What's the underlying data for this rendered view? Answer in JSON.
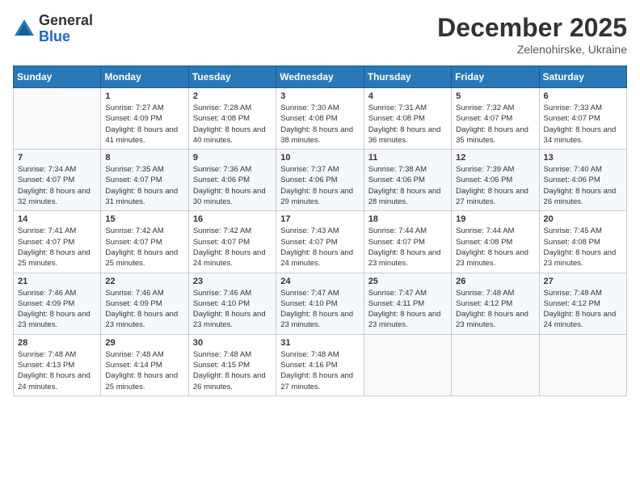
{
  "header": {
    "logo_general": "General",
    "logo_blue": "Blue",
    "month_title": "December 2025",
    "location": "Zelenohirske, Ukraine"
  },
  "weekdays": [
    "Sunday",
    "Monday",
    "Tuesday",
    "Wednesday",
    "Thursday",
    "Friday",
    "Saturday"
  ],
  "weeks": [
    [
      {
        "day": "",
        "sunrise": "",
        "sunset": "",
        "daylight": ""
      },
      {
        "day": "1",
        "sunrise": "Sunrise: 7:27 AM",
        "sunset": "Sunset: 4:09 PM",
        "daylight": "Daylight: 8 hours and 41 minutes."
      },
      {
        "day": "2",
        "sunrise": "Sunrise: 7:28 AM",
        "sunset": "Sunset: 4:08 PM",
        "daylight": "Daylight: 8 hours and 40 minutes."
      },
      {
        "day": "3",
        "sunrise": "Sunrise: 7:30 AM",
        "sunset": "Sunset: 4:08 PM",
        "daylight": "Daylight: 8 hours and 38 minutes."
      },
      {
        "day": "4",
        "sunrise": "Sunrise: 7:31 AM",
        "sunset": "Sunset: 4:08 PM",
        "daylight": "Daylight: 8 hours and 36 minutes."
      },
      {
        "day": "5",
        "sunrise": "Sunrise: 7:32 AM",
        "sunset": "Sunset: 4:07 PM",
        "daylight": "Daylight: 8 hours and 35 minutes."
      },
      {
        "day": "6",
        "sunrise": "Sunrise: 7:33 AM",
        "sunset": "Sunset: 4:07 PM",
        "daylight": "Daylight: 8 hours and 34 minutes."
      }
    ],
    [
      {
        "day": "7",
        "sunrise": "Sunrise: 7:34 AM",
        "sunset": "Sunset: 4:07 PM",
        "daylight": "Daylight: 8 hours and 32 minutes."
      },
      {
        "day": "8",
        "sunrise": "Sunrise: 7:35 AM",
        "sunset": "Sunset: 4:07 PM",
        "daylight": "Daylight: 8 hours and 31 minutes."
      },
      {
        "day": "9",
        "sunrise": "Sunrise: 7:36 AM",
        "sunset": "Sunset: 4:06 PM",
        "daylight": "Daylight: 8 hours and 30 minutes."
      },
      {
        "day": "10",
        "sunrise": "Sunrise: 7:37 AM",
        "sunset": "Sunset: 4:06 PM",
        "daylight": "Daylight: 8 hours and 29 minutes."
      },
      {
        "day": "11",
        "sunrise": "Sunrise: 7:38 AM",
        "sunset": "Sunset: 4:06 PM",
        "daylight": "Daylight: 8 hours and 28 minutes."
      },
      {
        "day": "12",
        "sunrise": "Sunrise: 7:39 AM",
        "sunset": "Sunset: 4:06 PM",
        "daylight": "Daylight: 8 hours and 27 minutes."
      },
      {
        "day": "13",
        "sunrise": "Sunrise: 7:40 AM",
        "sunset": "Sunset: 4:06 PM",
        "daylight": "Daylight: 8 hours and 26 minutes."
      }
    ],
    [
      {
        "day": "14",
        "sunrise": "Sunrise: 7:41 AM",
        "sunset": "Sunset: 4:07 PM",
        "daylight": "Daylight: 8 hours and 25 minutes."
      },
      {
        "day": "15",
        "sunrise": "Sunrise: 7:42 AM",
        "sunset": "Sunset: 4:07 PM",
        "daylight": "Daylight: 8 hours and 25 minutes."
      },
      {
        "day": "16",
        "sunrise": "Sunrise: 7:42 AM",
        "sunset": "Sunset: 4:07 PM",
        "daylight": "Daylight: 8 hours and 24 minutes."
      },
      {
        "day": "17",
        "sunrise": "Sunrise: 7:43 AM",
        "sunset": "Sunset: 4:07 PM",
        "daylight": "Daylight: 8 hours and 24 minutes."
      },
      {
        "day": "18",
        "sunrise": "Sunrise: 7:44 AM",
        "sunset": "Sunset: 4:07 PM",
        "daylight": "Daylight: 8 hours and 23 minutes."
      },
      {
        "day": "19",
        "sunrise": "Sunrise: 7:44 AM",
        "sunset": "Sunset: 4:08 PM",
        "daylight": "Daylight: 8 hours and 23 minutes."
      },
      {
        "day": "20",
        "sunrise": "Sunrise: 7:45 AM",
        "sunset": "Sunset: 4:08 PM",
        "daylight": "Daylight: 8 hours and 23 minutes."
      }
    ],
    [
      {
        "day": "21",
        "sunrise": "Sunrise: 7:46 AM",
        "sunset": "Sunset: 4:09 PM",
        "daylight": "Daylight: 8 hours and 23 minutes."
      },
      {
        "day": "22",
        "sunrise": "Sunrise: 7:46 AM",
        "sunset": "Sunset: 4:09 PM",
        "daylight": "Daylight: 8 hours and 23 minutes."
      },
      {
        "day": "23",
        "sunrise": "Sunrise: 7:46 AM",
        "sunset": "Sunset: 4:10 PM",
        "daylight": "Daylight: 8 hours and 23 minutes."
      },
      {
        "day": "24",
        "sunrise": "Sunrise: 7:47 AM",
        "sunset": "Sunset: 4:10 PM",
        "daylight": "Daylight: 8 hours and 23 minutes."
      },
      {
        "day": "25",
        "sunrise": "Sunrise: 7:47 AM",
        "sunset": "Sunset: 4:11 PM",
        "daylight": "Daylight: 8 hours and 23 minutes."
      },
      {
        "day": "26",
        "sunrise": "Sunrise: 7:48 AM",
        "sunset": "Sunset: 4:12 PM",
        "daylight": "Daylight: 8 hours and 23 minutes."
      },
      {
        "day": "27",
        "sunrise": "Sunrise: 7:48 AM",
        "sunset": "Sunset: 4:12 PM",
        "daylight": "Daylight: 8 hours and 24 minutes."
      }
    ],
    [
      {
        "day": "28",
        "sunrise": "Sunrise: 7:48 AM",
        "sunset": "Sunset: 4:13 PM",
        "daylight": "Daylight: 8 hours and 24 minutes."
      },
      {
        "day": "29",
        "sunrise": "Sunrise: 7:48 AM",
        "sunset": "Sunset: 4:14 PM",
        "daylight": "Daylight: 8 hours and 25 minutes."
      },
      {
        "day": "30",
        "sunrise": "Sunrise: 7:48 AM",
        "sunset": "Sunset: 4:15 PM",
        "daylight": "Daylight: 8 hours and 26 minutes."
      },
      {
        "day": "31",
        "sunrise": "Sunrise: 7:48 AM",
        "sunset": "Sunset: 4:16 PM",
        "daylight": "Daylight: 8 hours and 27 minutes."
      },
      {
        "day": "",
        "sunrise": "",
        "sunset": "",
        "daylight": ""
      },
      {
        "day": "",
        "sunrise": "",
        "sunset": "",
        "daylight": ""
      },
      {
        "day": "",
        "sunrise": "",
        "sunset": "",
        "daylight": ""
      }
    ]
  ]
}
